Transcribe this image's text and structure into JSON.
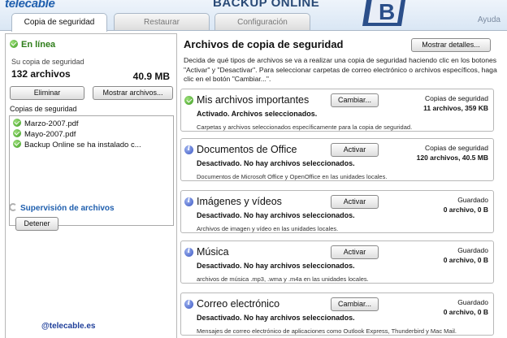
{
  "header": {
    "logo": "telecable",
    "app_title": "BACKUP ONLINE",
    "help_label": "Ayuda",
    "tabs": [
      {
        "label": "Copia de seguridad",
        "active": true
      },
      {
        "label": "Restaurar",
        "active": false
      },
      {
        "label": "Configuración",
        "active": false
      }
    ]
  },
  "left": {
    "status": "En línea",
    "backup_label": "Su copia de seguridad",
    "file_count": "132 archivos",
    "size": "40.9 MB",
    "delete_button": "Eliminar",
    "show_files_button": "Mostrar archivos...",
    "copies_label": "Copias de seguridad",
    "copies": [
      {
        "label": "Marzo-2007.pdf"
      },
      {
        "label": "Mayo-2007.pdf"
      },
      {
        "label": "Backup Online se ha instalado c..."
      }
    ],
    "sync_label": "Supervisión de archivos",
    "stop_button": "Detener",
    "footer_link": "@telecable.es"
  },
  "right": {
    "title": "Archivos de copia de seguridad",
    "details_button": "Mostrar detalles...",
    "description": "Decida de qué tipos de archivos se va a realizar una copia de seguridad haciendo clic en los botones \"Activar\" y \"Desactivar\". Para seleccionar carpetas de correo electrónico o archivos específicos, haga clic en el botón \"Cambiar...\".",
    "cards": [
      {
        "name": "Mis archivos importantes",
        "status": "Activado. Archivos seleccionados.",
        "sub": "Carpetas y archivos seleccionados específicamente para la copia de seguridad.",
        "button": "Cambiar...",
        "stat_label": "Copias de seguridad",
        "stat_value": "11 archivos, 359 KB",
        "icon": "check-icon"
      },
      {
        "name": "Documentos de Office",
        "status": "Desactivado. No hay archivos seleccionados.",
        "sub": "Documentos de Microsoft Office y OpenOffice en las unidades locales.",
        "button": "Activar",
        "stat_label": "Copias de seguridad",
        "stat_value": "120 archivos, 40.5 MB",
        "icon": "info-icon"
      },
      {
        "name": "Imágenes y vídeos",
        "status": "Desactivado. No hay archivos seleccionados.",
        "sub": "Archivos de imagen y vídeo en las unidades locales.",
        "button": "Activar",
        "stat_label": "Guardado",
        "stat_value": "0 archivo, 0 B",
        "icon": "info-icon"
      },
      {
        "name": "Música",
        "status": "Desactivado. No hay archivos seleccionados.",
        "sub": "archivos de música .mp3, .wma y .m4a en las unidades locales.",
        "button": "Activar",
        "stat_label": "Guardado",
        "stat_value": "0 archivo, 0 B",
        "icon": "info-icon"
      },
      {
        "name": "Correo electrónico",
        "status": "Desactivado. No hay archivos seleccionados.",
        "sub": "Mensajes de correo electrónico de aplicaciones como Outlook Express, Thunderbird y Mac Mail.",
        "button": "Cambiar...",
        "stat_label": "Guardado",
        "stat_value": "0 archivo, 0 B",
        "icon": "info-icon"
      }
    ]
  }
}
